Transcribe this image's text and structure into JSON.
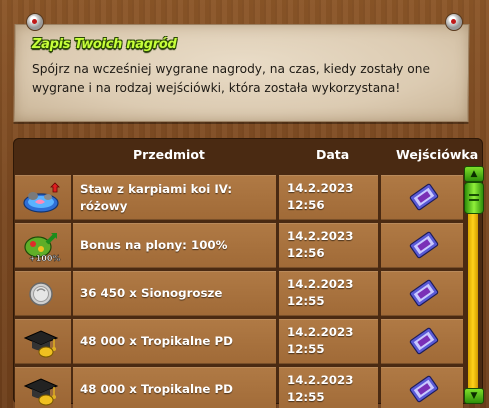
{
  "note": {
    "title": "Zapis Twoich nagród",
    "text": "Spójrz na wcześniej wygrane nagrody, na czas, kiedy zostały one wygrane i na rodzaj wejściówki, która została wykorzystana!"
  },
  "table": {
    "headers": {
      "item": "Przedmiot",
      "date": "Data",
      "ticket": "Wejściówka"
    },
    "rows": [
      {
        "icon": "koi-pond-icon",
        "name": "Staw z karpiami koi IV: różowy",
        "date": "14.2.2023",
        "time": "12:56"
      },
      {
        "icon": "harvest-bonus-icon",
        "name": "Bonus na plony: 100%",
        "date": "14.2.2023",
        "time": "12:56"
      },
      {
        "icon": "silver-coin-icon",
        "name": "36 450 x Sionogrosze",
        "date": "14.2.2023",
        "time": "12:55"
      },
      {
        "icon": "graduation-cap-icon",
        "name": "48 000 x Tropikalne PD",
        "date": "14.2.2023",
        "time": "12:55"
      },
      {
        "icon": "graduation-cap-icon",
        "name": "48 000 x Tropikalne PD",
        "date": "14.2.2023",
        "time": "12:55"
      }
    ]
  },
  "icon_badges": {
    "harvest": "+100%"
  },
  "colors": {
    "title_green": "#c6ff3a",
    "scrollbar_green": "#4cbf14",
    "scroll_track": "#ffd21a"
  }
}
